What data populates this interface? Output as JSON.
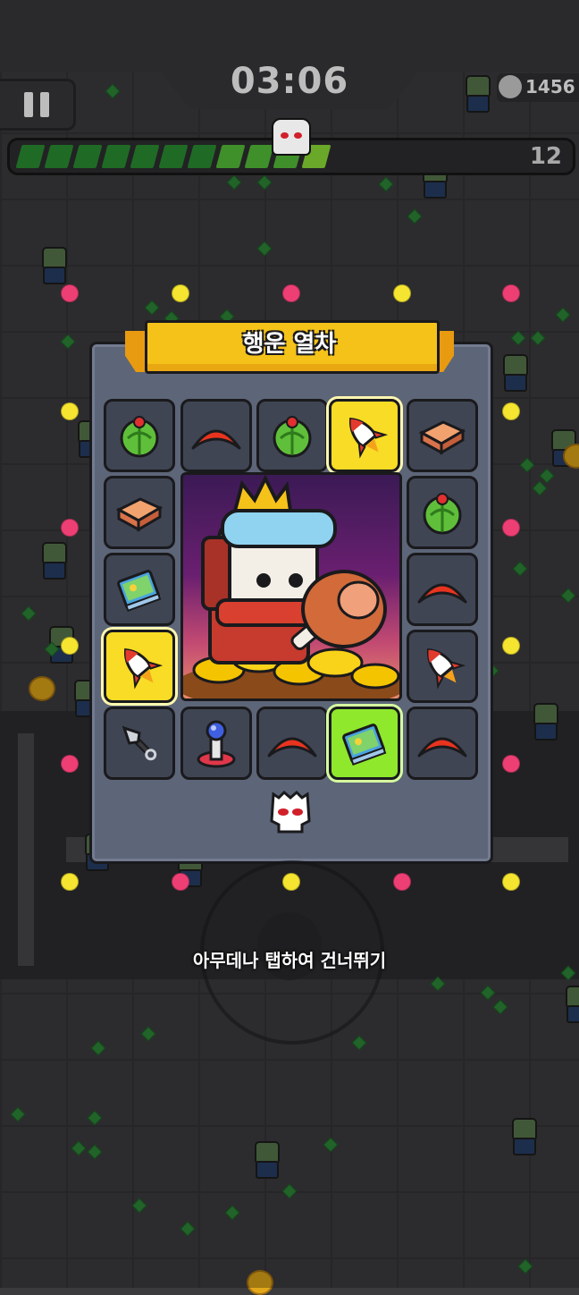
{
  "hud": {
    "timer": "03:06",
    "kill_count": "1456",
    "level": "12",
    "xp_progress": 0.62
  },
  "lucky_draw": {
    "title": "행운 열차",
    "slots": [
      {
        "item": "watermelon-icon",
        "highlight": "none"
      },
      {
        "item": "boomerang-icon",
        "highlight": "none"
      },
      {
        "item": "watermelon-icon",
        "highlight": "none"
      },
      {
        "item": "rocket-icon",
        "highlight": "yellow"
      },
      {
        "item": "brick-icon",
        "highlight": "none"
      },
      {
        "item": "brick-icon",
        "highlight": "none"
      },
      {
        "item": "watermelon-icon",
        "highlight": "none"
      },
      {
        "item": "book-icon",
        "highlight": "none"
      },
      {
        "item": "boomerang-icon",
        "highlight": "none"
      },
      {
        "item": "rocket-icon",
        "highlight": "yellow"
      },
      {
        "item": "rocket-icon",
        "highlight": "none"
      },
      {
        "item": "kunai-icon",
        "highlight": "none"
      },
      {
        "item": "tesla-coil-icon",
        "highlight": "none"
      },
      {
        "item": "boomerang-icon",
        "highlight": "none"
      },
      {
        "item": "book-icon",
        "highlight": "lime"
      },
      {
        "item": "boomerang-icon",
        "highlight": "none"
      }
    ]
  },
  "skip_hint": "아무데나 탭하여 건너뛰기",
  "colors": {
    "panel": "#5d6578",
    "ribbon": "#f5c219",
    "highlight_yellow": "#f8dc25",
    "highlight_lime": "#8fe82c",
    "xp_green": "#1f6b25"
  }
}
